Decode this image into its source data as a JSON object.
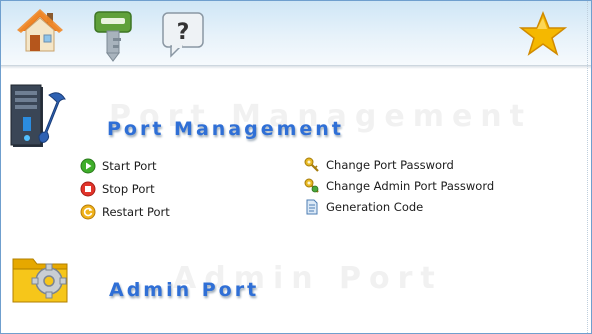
{
  "toolbar": {
    "icons": [
      "home-icon",
      "key-icon",
      "help-icon",
      "favorite-star-icon"
    ],
    "help_glyph": "?"
  },
  "port_management": {
    "title": "Port Management",
    "watermark": "Port Management",
    "left_actions": [
      {
        "label": "Start Port",
        "icon": "start-icon"
      },
      {
        "label": "Stop Port",
        "icon": "stop-icon"
      },
      {
        "label": "Restart Port",
        "icon": "restart-icon"
      }
    ],
    "right_actions": [
      {
        "label": "Change Port Password",
        "icon": "key-icon"
      },
      {
        "label": "Change Admin Port Password",
        "icon": "key-icon"
      },
      {
        "label": "Generation Code",
        "icon": "document-icon"
      }
    ]
  },
  "admin_port": {
    "title": "Admin Port",
    "watermark": "Admin Port"
  },
  "colors": {
    "title_blue": "#2f6fd6",
    "toolbar_top": "#cfe6f6",
    "frame_border": "#6f9fce"
  }
}
